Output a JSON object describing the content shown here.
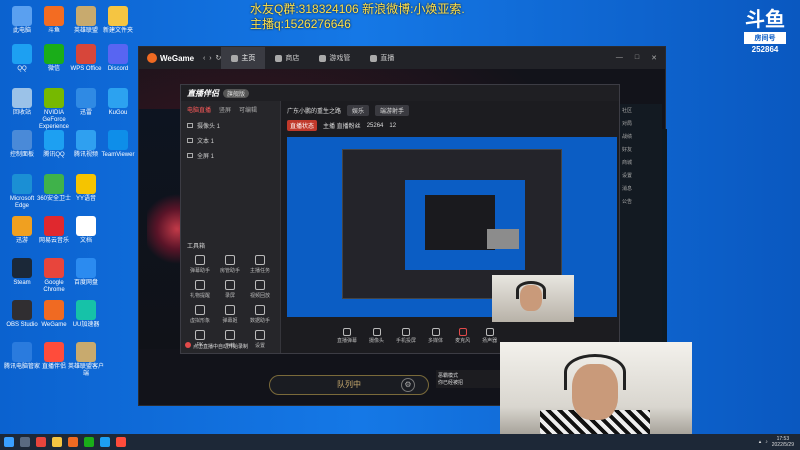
{
  "overlay": {
    "line1": "水友Q群:318324106 新浪微博:小焕亚索.",
    "line2": "主播q:1526276646"
  },
  "douyu": {
    "brand": "斗鱼",
    "room_label": "房间号",
    "room_number": "252864"
  },
  "desktop_icons": [
    {
      "label": "此电脑",
      "color": "#5aa0f0"
    },
    {
      "label": "QQ",
      "color": "#1da0f2"
    },
    {
      "label": "回收站",
      "color": "#9bc2e8"
    },
    {
      "label": "控制面板",
      "color": "#4a8ad8"
    },
    {
      "label": "Microsoft Edge",
      "color": "#1b8fd4"
    },
    {
      "label": "迅游",
      "color": "#f0a020"
    },
    {
      "label": "Steam",
      "color": "#1b2838"
    },
    {
      "label": "OBS Studio",
      "color": "#302e31"
    },
    {
      "label": "腾讯电脑管家",
      "color": "#2a7bde"
    },
    {
      "label": "斗鱼",
      "color": "#f36c22"
    },
    {
      "label": "微信",
      "color": "#1aad19"
    },
    {
      "label": "NVIDIA GeForce Experience",
      "color": "#76b900"
    },
    {
      "label": "腾讯QQ",
      "color": "#1da0f2"
    },
    {
      "label": "360安全卫士",
      "color": "#3fb24a"
    },
    {
      "label": "网易云音乐",
      "color": "#e0282e"
    },
    {
      "label": "Google Chrome",
      "color": "#e8453c"
    },
    {
      "label": "WeGame",
      "color": "#f06a22"
    },
    {
      "label": "直播伴侣",
      "color": "#ff4c3b"
    },
    {
      "label": "英雄联盟",
      "color": "#c8aa6e"
    },
    {
      "label": "WPS Office",
      "color": "#d7463a"
    },
    {
      "label": "迅雷",
      "color": "#2f8ae4"
    },
    {
      "label": "腾讯视频",
      "color": "#2fa0f0"
    },
    {
      "label": "YY语音",
      "color": "#f5c400"
    },
    {
      "label": "文档",
      "color": "#ffffff"
    },
    {
      "label": "百度网盘",
      "color": "#2b8bf0"
    },
    {
      "label": "UU加速器",
      "color": "#16c2a8"
    },
    {
      "label": "英雄联盟客户端",
      "color": "#c8aa6e"
    },
    {
      "label": "新建文件夹",
      "color": "#f5c542"
    },
    {
      "label": "Discord",
      "color": "#5865f2"
    },
    {
      "label": "KuGou",
      "color": "#2ca2f0"
    },
    {
      "label": "TeamViewer",
      "color": "#0e8ee9"
    }
  ],
  "wegame": {
    "brand": "WeGame",
    "tabs": [
      {
        "label": "主页"
      },
      {
        "label": "商店"
      },
      {
        "label": "游戏管"
      },
      {
        "label": "直播"
      }
    ],
    "queue_label": "队列中",
    "right_panel": [
      "社区",
      "对局",
      "战绩",
      "好友",
      "商城",
      "设置",
      "消息",
      "公告"
    ],
    "tip_lines": [
      "恶霸模式",
      "你已经被招"
    ]
  },
  "zhibo": {
    "title": "直播伴侣",
    "version": "旗舰版",
    "tabs": [
      "电脑直播",
      "竖屏",
      "可编辑"
    ],
    "sources": [
      "摄像头 1",
      "文本 1",
      "全屏 1"
    ],
    "tools_label": "工具箱",
    "tools": [
      "弹幕助手",
      "房管助手",
      "主播任务",
      "礼物提醒",
      "录屏",
      "视频回放",
      "虚拟形象",
      "弹幕姬",
      "数据助手",
      "PK",
      "下载",
      "设置"
    ],
    "stream_title": "广东小鹏的重生之路",
    "mode": "娱乐",
    "category": "端游射手",
    "status": "直播状态",
    "fan_label": "主播 直播粉丝",
    "count": "25264",
    "viewers": "12",
    "bottom": [
      "直播弹幕",
      "摄像头",
      "手机投屏",
      "多媒体",
      "麦克风",
      "扬声器"
    ],
    "warning": "点击直播中自动开始录制"
  },
  "taskbar": {
    "time": "17:53",
    "date": "2022/5/29"
  }
}
